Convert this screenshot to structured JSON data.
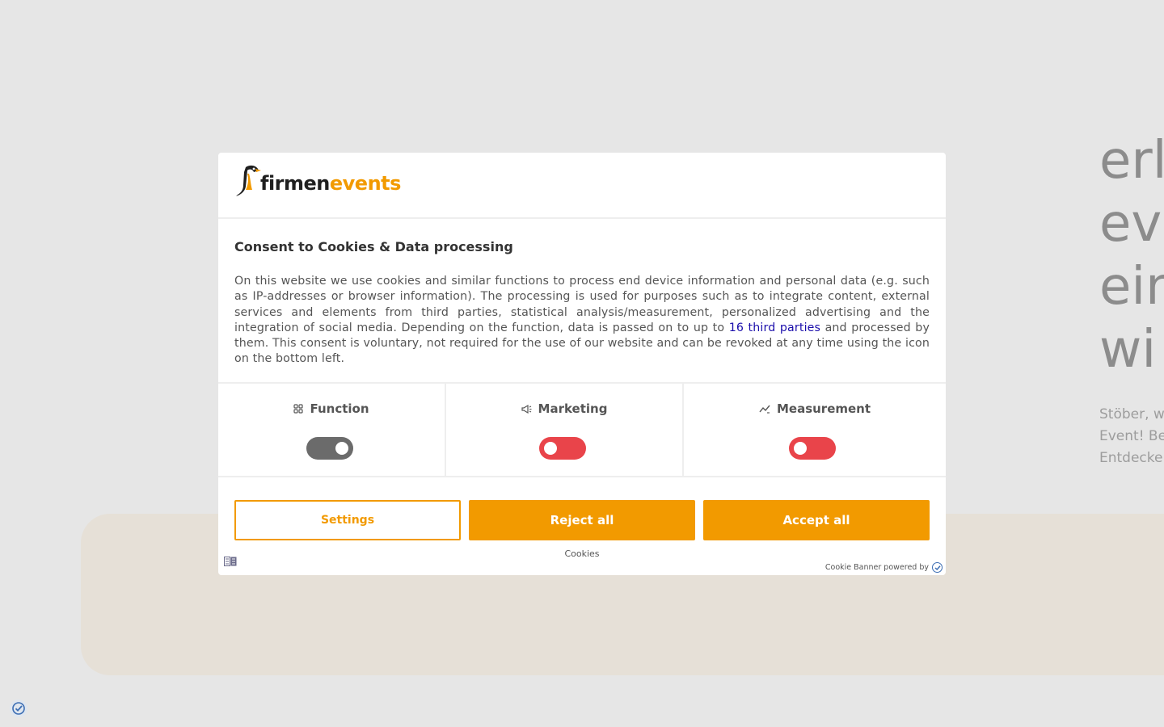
{
  "page": {
    "hero_title_lines": [
      "erl",
      "ev",
      "ein",
      "wi"
    ],
    "hero_sub_lines": [
      "Stöber, w",
      "Event! Be",
      "Entdecke"
    ]
  },
  "modal": {
    "logo": {
      "part1": "firmen",
      "part2": "events",
      "icon": "penguin-logo-icon"
    },
    "title": "Consent to Cookies & Data processing",
    "text_before_link": "On this website we use cookies and similar functions to process end device information and personal data (e.g. such as IP-addresses or browser information). The processing is used for purposes such as to integrate content, external services and elements from third parties, statistical analysis/measurement, personalized advertising and the integration of social media. Depending on the function, data is passed on to up to ",
    "link_text": "16 third parties",
    "text_after_link": " and processed by them. This consent is voluntary, not required for the use of our website and can be revoked at any time using the icon on the bottom left.",
    "categories": [
      {
        "label": "Function",
        "icon": "function-grid-icon",
        "enabled": true
      },
      {
        "label": "Marketing",
        "icon": "megaphone-icon",
        "enabled": false
      },
      {
        "label": "Measurement",
        "icon": "chart-line-icon",
        "enabled": false
      }
    ],
    "buttons": {
      "settings": "Settings",
      "reject": "Reject all",
      "accept": "Accept all"
    },
    "cookies_link": "Cookies",
    "powered_by": "Cookie Banner powered by"
  },
  "colors": {
    "accent": "#f29a00",
    "toggle_on": "#6b6b6b",
    "toggle_off": "#e9444a",
    "link": "#1a0dab"
  }
}
